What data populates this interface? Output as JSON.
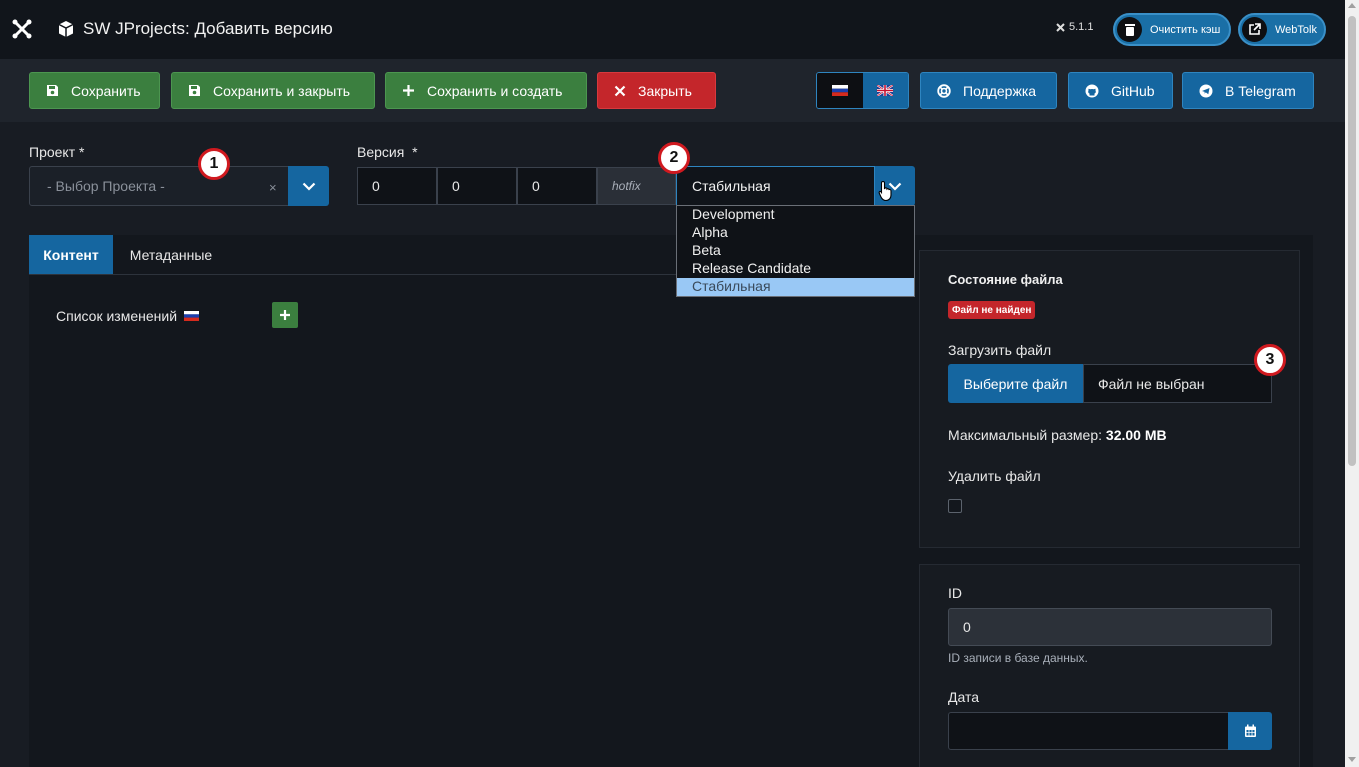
{
  "header": {
    "title": "SW JProjects: Добавить версию",
    "version": "5.1.1",
    "clear_cache_label": "Очистить кэш",
    "webtolk_label": "WebTolk"
  },
  "toolbar": {
    "save_label": "Сохранить",
    "save_close_label": "Сохранить и закрыть",
    "save_new_label": "Сохранить и создать",
    "close_label": "Закрыть",
    "support_label": "Поддержка",
    "github_label": "GitHub",
    "telegram_label": "В Telegram"
  },
  "form": {
    "project_label": "Проект *",
    "project_placeholder": "- Выбор Проекта -",
    "project_clear": "×",
    "version_label": "Версия  *",
    "major": "0",
    "minor": "0",
    "patch": "0",
    "hotfix_placeholder": "hotfix",
    "stability_value": "Стабильная",
    "stability_options": [
      "Development",
      "Alpha",
      "Beta",
      "Release Candidate",
      "Стабильная"
    ]
  },
  "annotations": [
    "1",
    "2",
    "3"
  ],
  "tabs": {
    "content_label": "Контент",
    "metadata_label": "Метаданные"
  },
  "content": {
    "changelog_label": "Список изменений"
  },
  "file_card": {
    "status_label": "Состояние файла",
    "status_badge": "Файл не найден",
    "upload_label": "Загрузить файл",
    "choose_file_label": "Выберите файл",
    "no_file_label": "Файл не выбран",
    "max_size_prefix": "Максимальный размер:",
    "max_size_value": "32.00 MB",
    "delete_label": "Удалить файл"
  },
  "meta_card": {
    "id_label": "ID",
    "id_value": "0",
    "id_help": "ID записи в базе данных.",
    "date_label": "Дата"
  },
  "colors": {
    "primary": "#1566a0",
    "success": "#3b7f3f",
    "danger": "#c4262b",
    "background": "#181c23"
  },
  "icons": [
    "joomla-icon",
    "box-icon",
    "trash-icon",
    "external-link-icon",
    "save-icon",
    "plus-icon",
    "close-icon",
    "lifebuoy-icon",
    "github-icon",
    "telegram-icon",
    "chevron-down-icon",
    "calendar-icon",
    "flag-ru-icon",
    "flag-uk-icon"
  ]
}
